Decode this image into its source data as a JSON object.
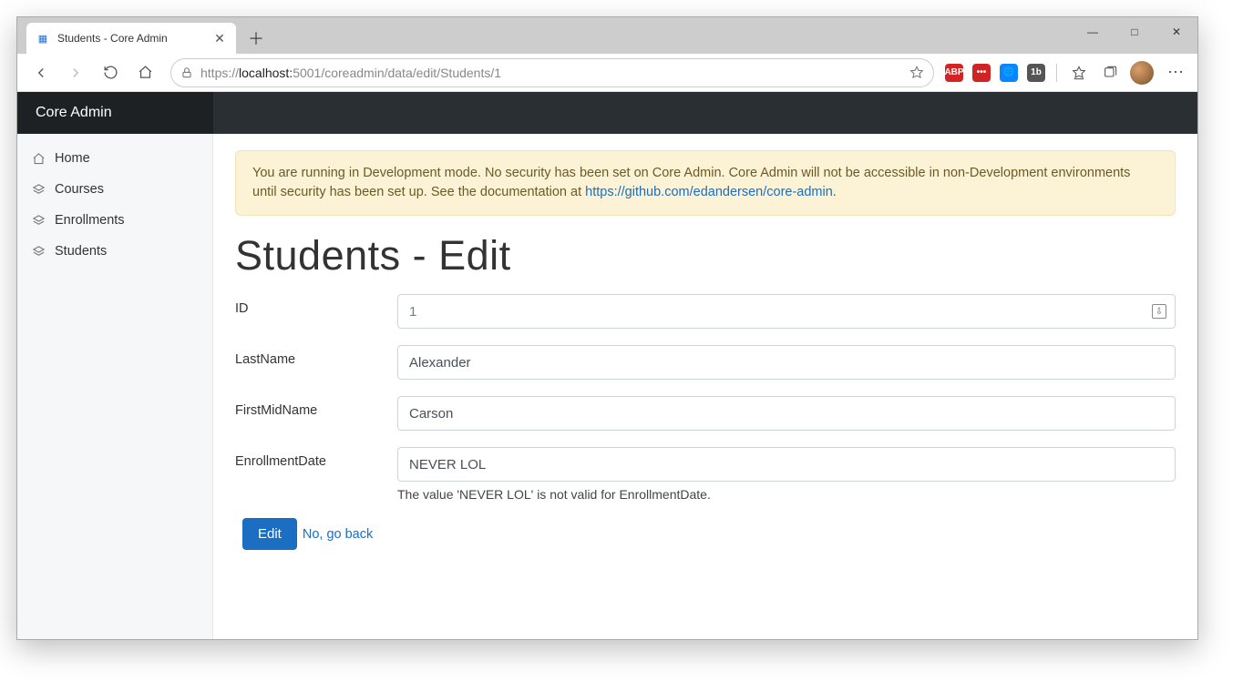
{
  "browser": {
    "tab_title": "Students - Core Admin",
    "url_scheme": "https://",
    "url_host": "localhost:",
    "url_port": "5001",
    "url_path": "/coreadmin/data/edit/Students/1"
  },
  "window_controls": {
    "minimize": "—",
    "maximize": "□",
    "close": "✕"
  },
  "toolbar_icons": {
    "back": "back-icon",
    "forward": "forward-icon",
    "refresh": "refresh-icon",
    "home": "home-icon",
    "lock": "lock-icon",
    "star": "star-icon"
  },
  "extensions": [
    {
      "name": "abp-icon",
      "label": "ABP",
      "bg": "#d32323"
    },
    {
      "name": "lastpass-icon",
      "label": "•••",
      "bg": "#d02424"
    },
    {
      "name": "globe-icon",
      "label": "🌐",
      "bg": "#0a84ff"
    },
    {
      "name": "onenote-icon",
      "label": "1b",
      "bg": "#555"
    }
  ],
  "app": {
    "brand": "Core Admin"
  },
  "sidebar": {
    "items": [
      {
        "label": "Home",
        "icon": "home-icon"
      },
      {
        "label": "Courses",
        "icon": "layers-icon"
      },
      {
        "label": "Enrollments",
        "icon": "layers-icon"
      },
      {
        "label": "Students",
        "icon": "layers-icon"
      }
    ]
  },
  "alert": {
    "text_before_link": "You are running in Development mode. No security has been set on Core Admin. Core Admin will not be accessible in non-Development environments until security has been set up. See the documentation at ",
    "link_text": "https://github.com/edandersen/core-admin",
    "text_after_link": "."
  },
  "page": {
    "title": "Students - Edit"
  },
  "form": {
    "fields": [
      {
        "label": "ID",
        "value": "1",
        "disabled": true,
        "badge": true
      },
      {
        "label": "LastName",
        "value": "Alexander"
      },
      {
        "label": "FirstMidName",
        "value": "Carson"
      },
      {
        "label": "EnrollmentDate",
        "value": "NEVER LOL",
        "validation": "The value 'NEVER LOL' is not valid for EnrollmentDate."
      }
    ],
    "submit_label": "Edit",
    "cancel_label": "No, go back"
  }
}
